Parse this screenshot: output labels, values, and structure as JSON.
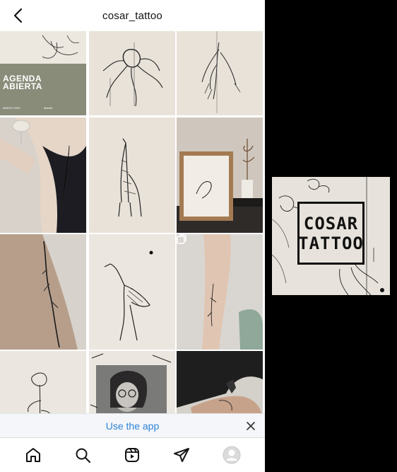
{
  "header": {
    "title": "cosar_tattoo",
    "back_icon": "chevron-left-icon"
  },
  "posts": {
    "agenda_card": {
      "line1": "AGENDA",
      "line2": "ABIERTA",
      "footer_date": "MARZO 2023",
      "footer_city": "Madrid",
      "background": "#8a8c7a"
    },
    "subjects": [
      "agenda-card",
      "octopus-drawing",
      "plant-drawing",
      "woman-wine-glass-tattoo",
      "giraffe-drawing",
      "framed-bird-print",
      "forearm-line-tattoo",
      "heron-drawing",
      "arm-sketch-tattoo",
      "flower-drawing",
      "portrait-collage",
      "upper-arm-tattoo"
    ]
  },
  "banner": {
    "use_app_label": "Use the app",
    "close_icon": "close-icon"
  },
  "tabbar": {
    "items": [
      "home-icon",
      "search-icon",
      "reels-icon",
      "send-icon",
      "profile-avatar"
    ]
  },
  "side_logo": {
    "line1": "COSAR",
    "line2": "TATTOO"
  },
  "colors": {
    "link_blue": "#2f84d6",
    "paper": "#e6e0d8",
    "side_background": "#000000"
  }
}
